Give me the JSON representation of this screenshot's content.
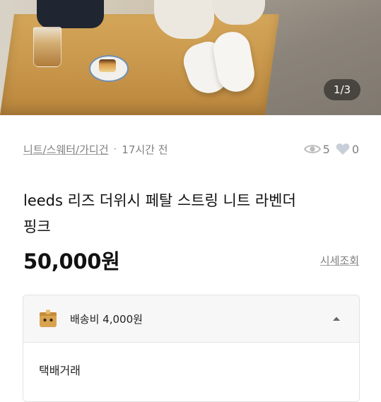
{
  "hero": {
    "image_counter": "1/3"
  },
  "meta": {
    "category": "니트/스웨터/가디건",
    "separator": "·",
    "time_ago": "17시간 전",
    "views": "5",
    "likes": "0"
  },
  "product": {
    "title_line1": "leeds 리즈 더위시 페탈 스트링 니트 라벤더",
    "title_line2": "핑크",
    "price": "50,000원",
    "market_price_link": "시세조회"
  },
  "shipping": {
    "fee": "배송비 4,000원",
    "method": "택배거래"
  },
  "colors": {
    "meta_text": "#808080",
    "card_header_bg": "#f7f7f7",
    "box_icon": "#d9a24e",
    "icon_gray": "#bcbcbc"
  }
}
